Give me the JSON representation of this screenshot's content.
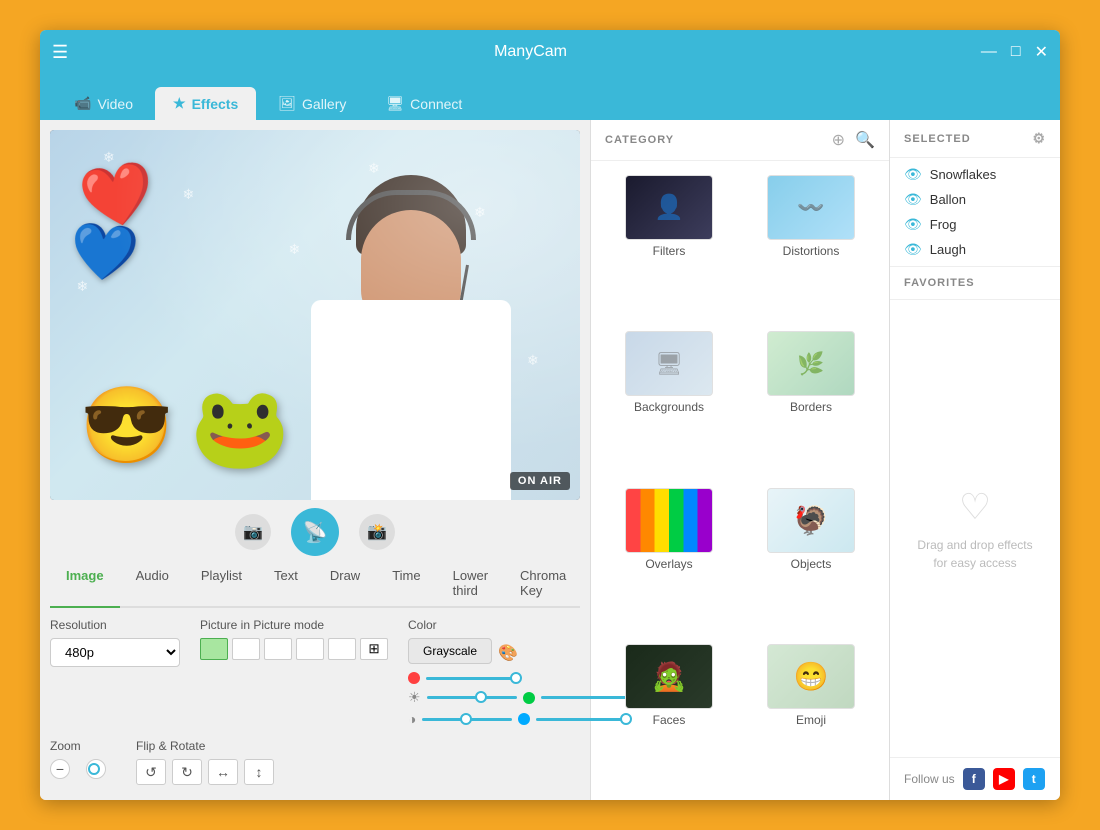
{
  "app": {
    "title": "ManyCam",
    "window_controls": [
      "—",
      "□",
      "✕"
    ]
  },
  "navbar": {
    "tabs": [
      {
        "id": "video",
        "label": "Video",
        "icon": "📹",
        "active": false
      },
      {
        "id": "effects",
        "label": "Effects",
        "icon": "★",
        "active": true
      },
      {
        "id": "gallery",
        "label": "Gallery",
        "icon": "🖼",
        "active": false
      },
      {
        "id": "connect",
        "label": "Connect",
        "icon": "🖥",
        "active": false
      }
    ]
  },
  "category": {
    "title": "CATEGORY",
    "items": [
      {
        "id": "filters",
        "label": "Filters",
        "thumb": "filters"
      },
      {
        "id": "distortions",
        "label": "Distortions",
        "thumb": "distortions"
      },
      {
        "id": "backgrounds",
        "label": "Backgrounds",
        "thumb": "backgrounds"
      },
      {
        "id": "borders",
        "label": "Borders",
        "thumb": "borders"
      },
      {
        "id": "overlays",
        "label": "Overlays",
        "thumb": "overlays"
      },
      {
        "id": "objects",
        "label": "Objects",
        "thumb": "objects"
      },
      {
        "id": "faces1",
        "label": "Faces",
        "thumb": "faces1"
      },
      {
        "id": "faces2",
        "label": "Emoji",
        "thumb": "faces2"
      }
    ]
  },
  "selected": {
    "header": "SELECTED",
    "items": [
      {
        "label": "Snowflakes"
      },
      {
        "label": "Ballon"
      },
      {
        "label": "Frog"
      },
      {
        "label": "Laugh"
      }
    ]
  },
  "favorites": {
    "header": "FAVORITES",
    "drag_text": "Drag and drop effects for easy access"
  },
  "follow": {
    "label": "Follow us"
  },
  "preview": {
    "on_air": "ON AIR"
  },
  "tabs": {
    "items": [
      {
        "label": "Image",
        "active": true
      },
      {
        "label": "Audio",
        "active": false
      },
      {
        "label": "Playlist",
        "active": false
      },
      {
        "label": "Text",
        "active": false
      },
      {
        "label": "Draw",
        "active": false
      },
      {
        "label": "Time",
        "active": false
      },
      {
        "label": "Lower third",
        "active": false
      },
      {
        "label": "Chroma Key",
        "active": false
      }
    ]
  },
  "settings": {
    "resolution_label": "Resolution",
    "resolution_value": "480p",
    "pip_label": "Picture in Picture mode",
    "color_label": "Color",
    "color_btn": "Grayscale",
    "zoom_label": "Zoom",
    "flip_label": "Flip & Rotate"
  }
}
